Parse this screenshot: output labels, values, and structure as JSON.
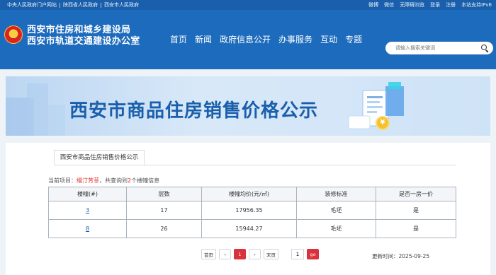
{
  "topbar": {
    "links": [
      "中央人民政府门户网站",
      "陕西省人民政府",
      "西安市人民政府"
    ],
    "right": [
      "微博",
      "微信",
      "无障碍浏览",
      "登录",
      "注册",
      "本站支持IPv6"
    ]
  },
  "header": {
    "title_line1": "西安市住房和城乡建设局",
    "title_line2": "西安市轨道交通建设办公室",
    "nav": [
      "首页",
      "新闻",
      "政府信息公开",
      "办事服务",
      "互动",
      "专题"
    ],
    "search_placeholder": "请输入搜索关键词"
  },
  "banner": {
    "title": "西安市商品住房销售价格公示",
    "coin_symbol": "¥"
  },
  "content": {
    "tab_label": "西安市商品住房销售价格公示",
    "info_prefix": "当前项目：",
    "project_name": "缦汀芳菲",
    "info_middle": "，共查询到",
    "count": "2",
    "info_suffix": "个楼幢信息",
    "table": {
      "headers": [
        "楼幢(#)",
        "层数",
        "楼幢均价(元/㎡)",
        "装修标准",
        "是否一房一价"
      ],
      "rows": [
        [
          "3",
          "17",
          "17956.35",
          "毛坯",
          "是"
        ],
        [
          "8",
          "26",
          "15944.27",
          "毛坯",
          "是"
        ]
      ]
    },
    "pager": {
      "first": "首页",
      "prev": "‹",
      "current": "1",
      "next": "›",
      "last": "末页",
      "input_value": "1",
      "go": "go"
    },
    "update_time": "更新时间：2025-09-25"
  }
}
